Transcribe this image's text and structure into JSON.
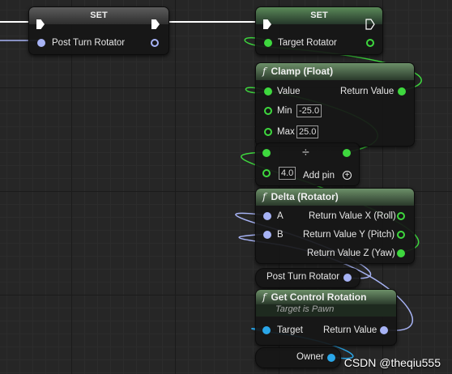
{
  "set_left": {
    "title": "SET",
    "pin_label": "Post Turn Rotator"
  },
  "set_right": {
    "title": "SET",
    "pin_label": "Target Rotator"
  },
  "clamp": {
    "title": "Clamp (Float)",
    "icon": "f",
    "value_label": "Value",
    "return_label": "Return Value",
    "min_label": "Min",
    "min_value": "-25.0",
    "max_label": "Max",
    "max_value": "25.0"
  },
  "divide": {
    "symbol": "÷",
    "value": "4.0",
    "add_pin_label": "Add pin"
  },
  "delta": {
    "title": "Delta (Rotator)",
    "icon": "f",
    "a_label": "A",
    "b_label": "B",
    "rx_label": "Return Value X (Roll)",
    "ry_label": "Return Value Y (Pitch)",
    "rz_label": "Return Value Z (Yaw)"
  },
  "get_post": {
    "label": "Post Turn Rotator"
  },
  "get_control": {
    "title": "Get Control Rotation",
    "icon": "f",
    "subtitle": "Target is Pawn",
    "target_label": "Target",
    "return_label": "Return Value"
  },
  "owner": {
    "label": "Owner"
  },
  "watermark": "CSDN @theqiu555",
  "colors": {
    "float_pin": "#3ed83e",
    "rotator_pin": "#a7b3f5",
    "object_pin": "#2aa6e8",
    "exec_wire": "#ffffff"
  }
}
